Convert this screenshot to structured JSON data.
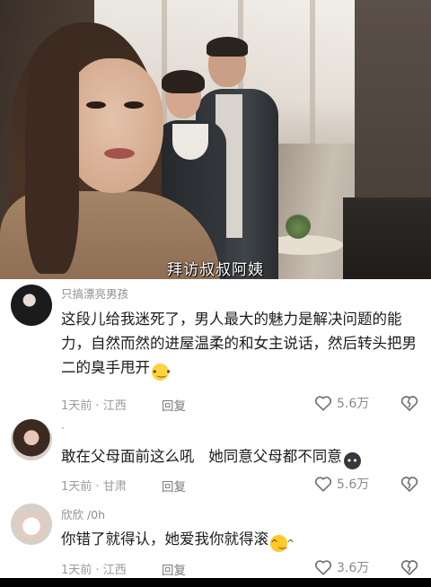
{
  "video": {
    "subtitle": "拜访叔叔阿姨"
  },
  "comments": [
    {
      "username": "只搞漂亮男孩",
      "text": "这段儿给我迷死了，男人最大的魅力是解决问题的能力，自然而然的进屋温柔的和女主说话，然后转头把男二的臭手甩开",
      "emoji": "pleading-face",
      "time": "1天前",
      "location": "江西",
      "reply_label": "回复",
      "likes": "5.6万"
    },
    {
      "username": "·",
      "text": "敢在父母面前这么吼   她同意父母都不同意",
      "emoji": "dark-face",
      "time": "1天前",
      "location": "甘肃",
      "reply_label": "回复",
      "likes": "5.6万"
    },
    {
      "username": "欣欣 /0h",
      "text": "你错了就得认，她爱我你就得滚",
      "emoji": "laughing-face",
      "time": "1天前",
      "location": "江西",
      "reply_label": "回复",
      "likes": "3.6万"
    }
  ],
  "colors": {
    "text": "#1b1b1b",
    "muted": "#9a9a9a",
    "username": "#8e8e8e"
  }
}
